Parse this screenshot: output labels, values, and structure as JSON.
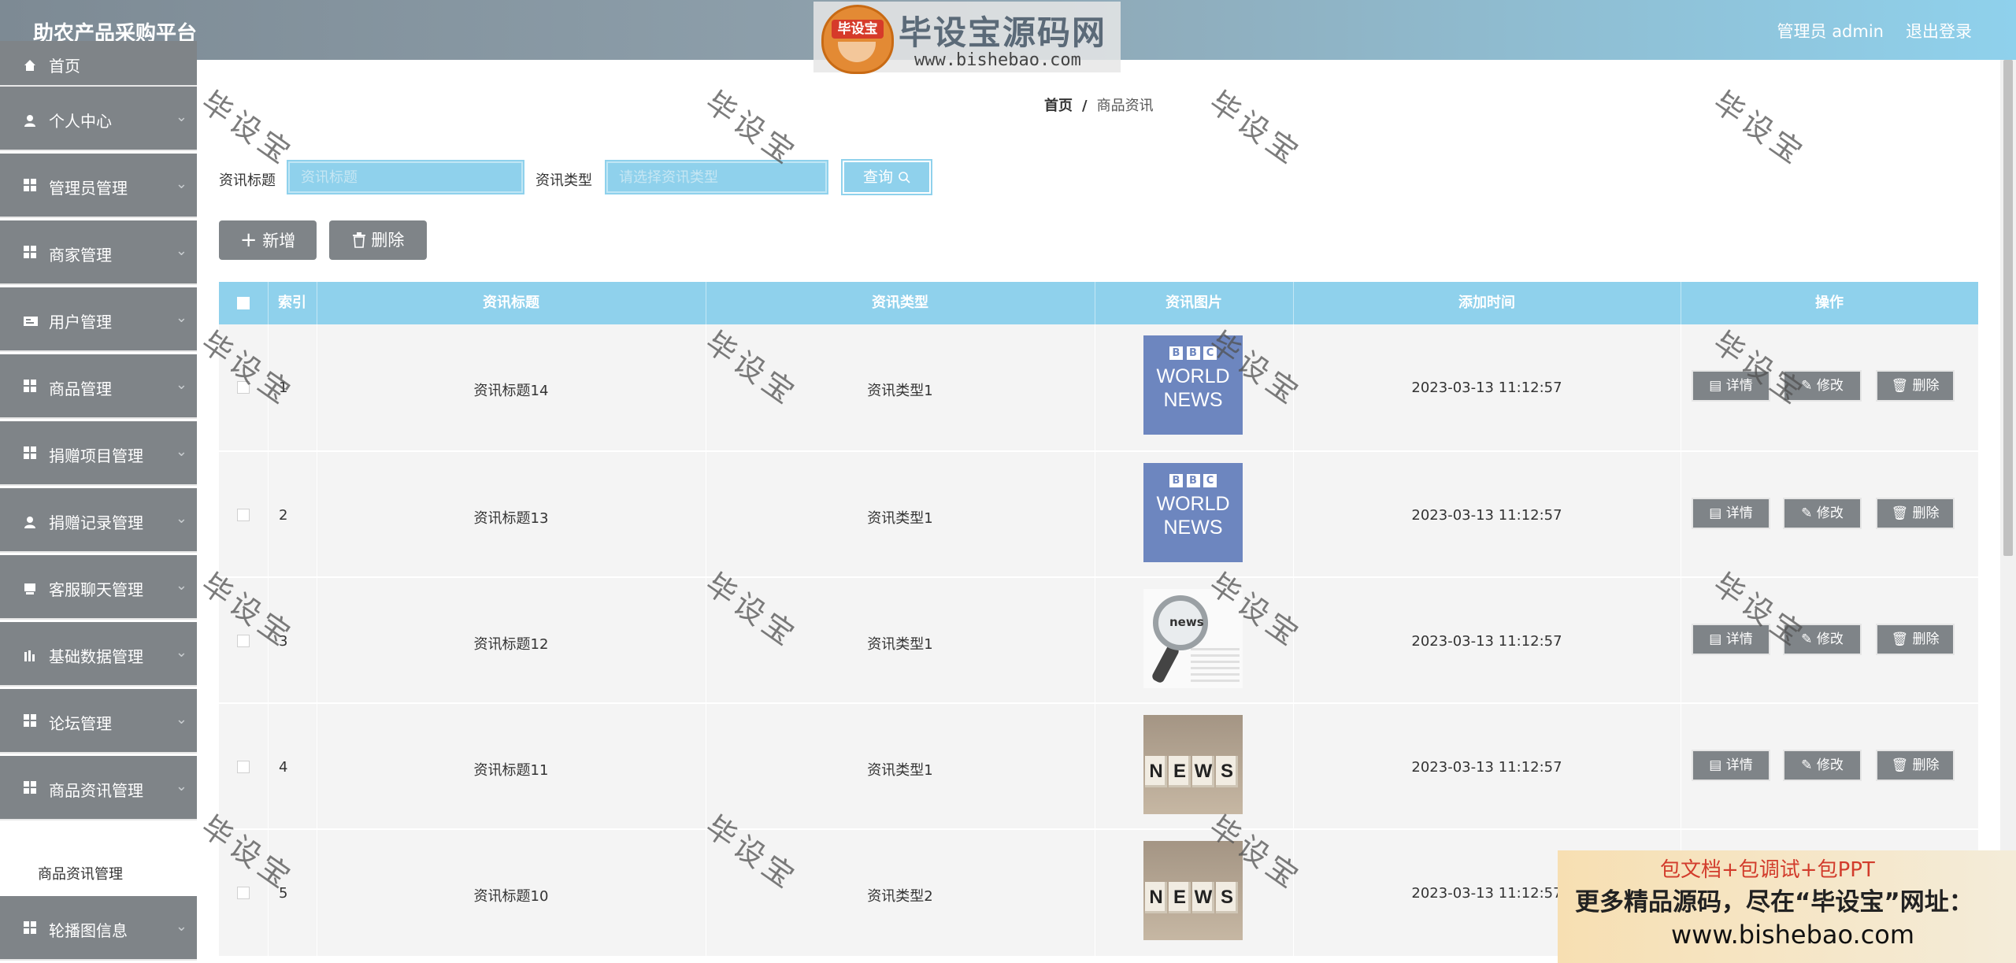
{
  "header": {
    "app_title": "助农产品采购平台",
    "user_label": "管理员 admin",
    "logout_label": "退出登录"
  },
  "watermark": {
    "mascot_text": "毕设宝",
    "brand": "毕设宝源码网",
    "domain": "www.bishebao.com",
    "diagonal_text": "毕设宝"
  },
  "sidebar": {
    "items": [
      {
        "label": "首页",
        "icon": "home-icon"
      },
      {
        "label": "个人中心",
        "icon": "user-icon"
      },
      {
        "label": "管理员管理",
        "icon": "grid-icon"
      },
      {
        "label": "商家管理",
        "icon": "grid-icon"
      },
      {
        "label": "用户管理",
        "icon": "card-icon"
      },
      {
        "label": "商品管理",
        "icon": "grid-icon"
      },
      {
        "label": "捐赠项目管理",
        "icon": "grid-icon"
      },
      {
        "label": "捐赠记录管理",
        "icon": "user-icon"
      },
      {
        "label": "客服聊天管理",
        "icon": "chat-icon"
      },
      {
        "label": "基础数据管理",
        "icon": "chart-icon"
      },
      {
        "label": "论坛管理",
        "icon": "grid-icon"
      },
      {
        "label": "商品资讯管理",
        "icon": "grid-icon"
      },
      {
        "label": "轮播图信息",
        "icon": "grid-icon"
      }
    ],
    "sub_item": "商品资讯管理"
  },
  "breadcrumb": {
    "home": "首页",
    "sep": "/",
    "current": "商品资讯"
  },
  "search": {
    "title_label": "资讯标题",
    "title_placeholder": "资讯标题",
    "type_label": "资讯类型",
    "type_placeholder": "请选择资讯类型",
    "query_label": "查询"
  },
  "actions": {
    "add": "新增",
    "delete": "删除"
  },
  "table": {
    "headers": [
      "",
      "索引",
      "资讯标题",
      "资讯类型",
      "资讯图片",
      "添加时间",
      "操作"
    ],
    "rows": [
      {
        "index": "1",
        "title": "资讯标题14",
        "type": "资讯类型1",
        "image": "bbc",
        "time": "2023-03-13 11:12:57"
      },
      {
        "index": "2",
        "title": "资讯标题13",
        "type": "资讯类型1",
        "image": "bbc",
        "time": "2023-03-13 11:12:57"
      },
      {
        "index": "3",
        "title": "资讯标题12",
        "type": "资讯类型1",
        "image": "magnifier",
        "time": "2023-03-13 11:12:57"
      },
      {
        "index": "4",
        "title": "资讯标题11",
        "type": "资讯类型1",
        "image": "cubes",
        "time": "2023-03-13 11:12:57"
      },
      {
        "index": "5",
        "title": "资讯标题10",
        "type": "资讯类型2",
        "image": "cubes",
        "time": "2023-03-13 11:12:57"
      }
    ],
    "ops": {
      "detail": "详情",
      "edit": "修改",
      "delete": "删除"
    },
    "bbc_logo": [
      "B",
      "B",
      "C"
    ],
    "bbc_line1": "WORLD",
    "bbc_line2": "NEWS",
    "mag_text": "news",
    "cube_letters": [
      "N",
      "E",
      "W",
      "S"
    ]
  },
  "ad": {
    "line1": "包文档+包调试+包PPT",
    "line2": "更多精品源码，尽在“毕设宝”网址：",
    "line3": "www.bishebao.com"
  },
  "colors": {
    "accent": "#8fd1ec",
    "sidebar": "#7f8488",
    "header_from": "#7d8a94",
    "header_to": "#8fd1ec"
  }
}
